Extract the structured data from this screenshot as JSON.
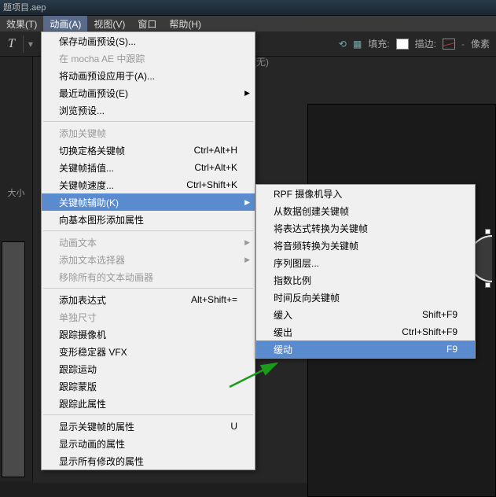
{
  "titlebar": {
    "text": "题项目.aep"
  },
  "menubar": {
    "items": [
      {
        "label": "效果(T)"
      },
      {
        "label": "动画(A)"
      },
      {
        "label": "视图(V)"
      },
      {
        "label": "窗口"
      },
      {
        "label": "帮助(H)"
      }
    ]
  },
  "toolbar": {
    "fill_label": "填充:",
    "stroke_label": "描边:",
    "px_label": "像素",
    "none_text": "(无)"
  },
  "left_panel": {
    "size_label": "大小"
  },
  "main_menu": [
    {
      "label": "保存动画预设(S)..."
    },
    {
      "label": "在 mocha AE 中跟踪",
      "disabled": true
    },
    {
      "label": "将动画预设应用于(A)..."
    },
    {
      "label": "最近动画预设(E)",
      "arrow": true
    },
    {
      "label": "浏览预设..."
    },
    {
      "sep": true
    },
    {
      "label": "添加关键帧",
      "disabled": true
    },
    {
      "label": "切换定格关键帧",
      "shortcut": "Ctrl+Alt+H"
    },
    {
      "label": "关键帧插值...",
      "shortcut": "Ctrl+Alt+K"
    },
    {
      "label": "关键帧速度...",
      "shortcut": "Ctrl+Shift+K"
    },
    {
      "label": "关键帧辅助(K)",
      "arrow": true,
      "active": true
    },
    {
      "label": "向基本图形添加属性"
    },
    {
      "sep": true
    },
    {
      "label": "动画文本",
      "arrow": true,
      "disabled": true
    },
    {
      "label": "添加文本选择器",
      "arrow": true,
      "disabled": true
    },
    {
      "label": "移除所有的文本动画器",
      "disabled": true
    },
    {
      "sep": true
    },
    {
      "label": "添加表达式",
      "shortcut": "Alt+Shift+="
    },
    {
      "label": "单独尺寸",
      "disabled": true
    },
    {
      "label": "跟踪摄像机"
    },
    {
      "label": "变形稳定器 VFX"
    },
    {
      "label": "跟踪运动"
    },
    {
      "label": "跟踪蒙版"
    },
    {
      "label": "跟踪此属性"
    },
    {
      "sep": true
    },
    {
      "label": "显示关键帧的属性",
      "shortcut": "U"
    },
    {
      "label": "显示动画的属性"
    },
    {
      "label": "显示所有修改的属性"
    }
  ],
  "sub_menu": [
    {
      "label": "RPF 摄像机导入"
    },
    {
      "label": "从数据创建关键帧"
    },
    {
      "label": "将表达式转换为关键帧"
    },
    {
      "label": "将音频转换为关键帧"
    },
    {
      "label": "序列图层..."
    },
    {
      "label": "指数比例"
    },
    {
      "label": "时间反向关键帧"
    },
    {
      "label": "缓入",
      "shortcut": "Shift+F9"
    },
    {
      "label": "缓出",
      "shortcut": "Ctrl+Shift+F9"
    },
    {
      "label": "缓动",
      "shortcut": "F9",
      "active": true
    }
  ]
}
